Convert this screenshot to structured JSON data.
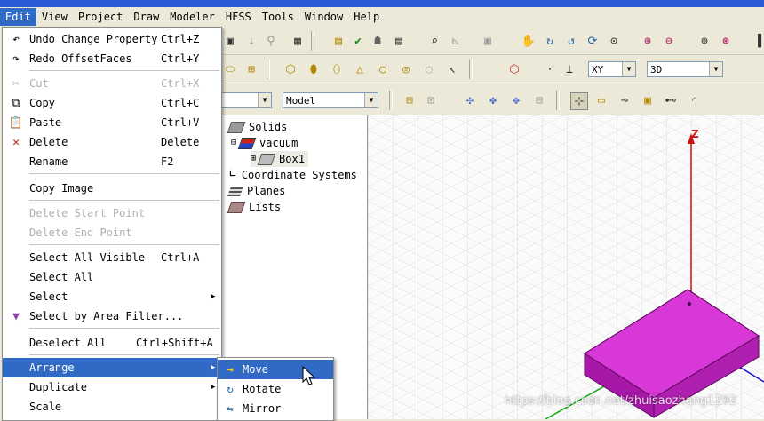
{
  "menubar": {
    "items": [
      {
        "label": "Edit"
      },
      {
        "label": "View"
      },
      {
        "label": "Project"
      },
      {
        "label": "Draw"
      },
      {
        "label": "Modeler"
      },
      {
        "label": "HFSS"
      },
      {
        "label": "Tools"
      },
      {
        "label": "Window"
      },
      {
        "label": "Help"
      }
    ]
  },
  "toolbar": {
    "plane_select": "XY",
    "view_select": "3D",
    "material_select": "Model"
  },
  "edit_menu": {
    "undo": {
      "label": "Undo Change Property",
      "shortcut": "Ctrl+Z"
    },
    "redo": {
      "label": "Redo OffsetFaces",
      "shortcut": "Ctrl+Y"
    },
    "cut": {
      "label": "Cut",
      "shortcut": "Ctrl+X"
    },
    "copy": {
      "label": "Copy",
      "shortcut": "Ctrl+C"
    },
    "paste": {
      "label": "Paste",
      "shortcut": "Ctrl+V"
    },
    "delete": {
      "label": "Delete",
      "shortcut": "Delete"
    },
    "rename": {
      "label": "Rename",
      "shortcut": "F2"
    },
    "copy_image": {
      "label": "Copy Image"
    },
    "delete_start_point": {
      "label": "Delete Start Point"
    },
    "delete_end_point": {
      "label": "Delete End Point"
    },
    "select_all_visible": {
      "label": "Select All Visible",
      "shortcut": "Ctrl+A"
    },
    "select_all": {
      "label": "Select All"
    },
    "select": {
      "label": "Select"
    },
    "select_by_area": {
      "label": "Select by Area Filter..."
    },
    "deselect_all": {
      "label": "Deselect All",
      "shortcut": "Ctrl+Shift+A"
    },
    "arrange": {
      "label": "Arrange"
    },
    "duplicate": {
      "label": "Duplicate"
    },
    "scale": {
      "label": "Scale"
    }
  },
  "arrange_submenu": {
    "move": "Move",
    "rotate": "Rotate",
    "mirror": "Mirror"
  },
  "tree": {
    "solids": "Solids",
    "vacuum": "vacuum",
    "box1": "Box1",
    "coordinate_systems": "Coordinate Systems",
    "planes": "Planes",
    "lists": "Lists"
  },
  "viewport": {
    "z_axis_label": "Z",
    "object_color": "#c020c0"
  },
  "watermark": "https://blog.csdn.net/zhuisaozhang1292"
}
